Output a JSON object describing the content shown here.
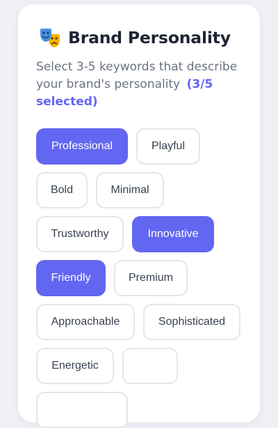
{
  "header": {
    "icon": "theater-masks-icon",
    "title": "Brand Personality"
  },
  "subtitle": {
    "text": "Select 3-5 keywords that describe your brand's personality",
    "count": "(3/5 selected)"
  },
  "colors": {
    "accent": "#6366f1",
    "chip_border": "#e2e6ee",
    "chip_text": "#384152"
  },
  "keywords": [
    {
      "label": "Professional",
      "selected": true
    },
    {
      "label": "Playful",
      "selected": false
    },
    {
      "label": "Bold",
      "selected": false
    },
    {
      "label": "Minimal",
      "selected": false
    },
    {
      "label": "Trustworthy",
      "selected": false
    },
    {
      "label": "Innovative",
      "selected": true
    },
    {
      "label": "Friendly",
      "selected": true
    },
    {
      "label": "Premium",
      "selected": false
    },
    {
      "label": "Approachable",
      "selected": false
    },
    {
      "label": "Sophisticated",
      "selected": false
    },
    {
      "label": "Energetic",
      "selected": false
    },
    {
      "label": "",
      "selected": false
    },
    {
      "label": "",
      "selected": false
    }
  ]
}
